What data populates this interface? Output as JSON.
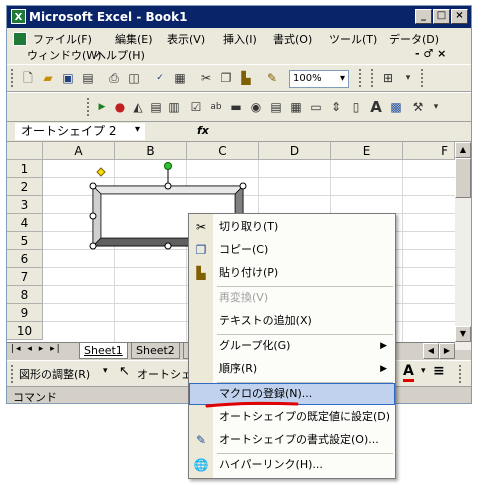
{
  "title": "Microsoft Excel - Book1",
  "caption_buttons": {
    "minimize": "_",
    "restore": "□",
    "close": "×"
  },
  "menubar": {
    "items": [
      "ファイル(F)",
      "編集(E)",
      "表示(V)",
      "挿入(I)",
      "書式(O)",
      "ツール(T)",
      "データ(D)"
    ],
    "items2": [
      "ウィンドウ(W)",
      "ヘルプ(H)"
    ],
    "doc_controls": "- ♂ ×"
  },
  "toolbar": {
    "zoom": "100%"
  },
  "namebox": {
    "value": "オートシェイプ 2"
  },
  "formula": {
    "fx": "fx"
  },
  "grid": {
    "columns": [
      "A",
      "B",
      "C",
      "D",
      "E",
      "F"
    ],
    "rows": [
      "1",
      "2",
      "3",
      "4",
      "5",
      "6",
      "7",
      "8",
      "9",
      "10"
    ]
  },
  "sheets": {
    "tabs": [
      "Sheet1",
      "Sheet2",
      "S"
    ]
  },
  "drawing": {
    "adjust": "図形の調整(R)",
    "autoshape": "オートシェ"
  },
  "status": {
    "mode": "コマンド"
  },
  "context_menu": {
    "items": [
      {
        "label": "切り取り(T)",
        "icon": "scissors-icon",
        "enabled": true
      },
      {
        "label": "コピー(C)",
        "icon": "copy-icon",
        "enabled": true
      },
      {
        "label": "貼り付け(P)",
        "icon": "paste-icon",
        "enabled": true
      },
      {
        "label": "再変換(V)",
        "icon": "",
        "enabled": false
      },
      {
        "label": "テキストの追加(X)",
        "icon": "",
        "enabled": true
      },
      {
        "label": "グループ化(G)",
        "icon": "",
        "enabled": true,
        "submenu": true
      },
      {
        "label": "順序(R)",
        "icon": "",
        "enabled": true,
        "submenu": true
      },
      {
        "label": "マクロの登録(N)...",
        "icon": "",
        "enabled": true,
        "highlighted": true
      },
      {
        "label": "オートシェイプの既定値に設定(D)",
        "icon": "",
        "enabled": true
      },
      {
        "label": "オートシェイプの書式設定(O)...",
        "icon": "format-icon",
        "enabled": true
      },
      {
        "label": "ハイパーリンク(H)...",
        "icon": "hyperlink-icon",
        "enabled": true
      }
    ]
  },
  "colors": {
    "titlebar": "#0a246a",
    "highlight": "#c1d2ee",
    "underline": "#e00000",
    "excel_green": "#1f7a38"
  }
}
